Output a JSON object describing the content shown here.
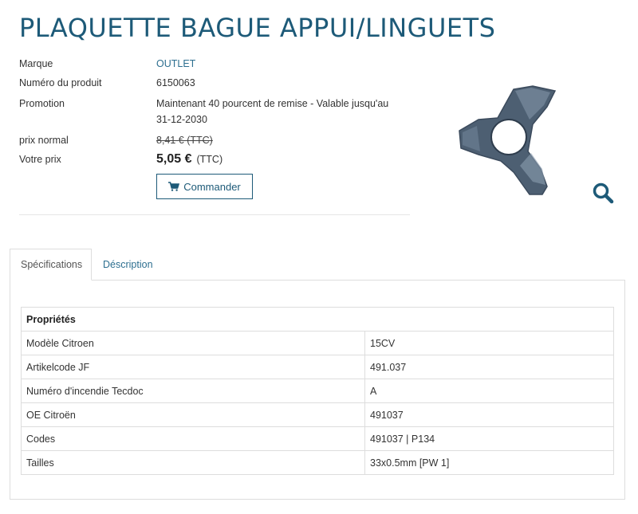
{
  "product": {
    "title": "PLAQUETTE BAGUE APPUI/LINGUETS",
    "brand_label": "Marque",
    "brand_value": "OUTLET",
    "number_label": "Numéro du produit",
    "number_value": "6150063",
    "promo_label": "Promotion",
    "promo_line1": "Maintenant 40 pourcent de remise - Valable jusqu'au",
    "promo_line2": "31-12-2030",
    "normal_label": "prix normal",
    "normal_value": "8,41 €  (TTC)",
    "price_label": "Votre prix",
    "price_amount": "5,05 €",
    "price_suffix": "(TTC)",
    "order_label": "Commander"
  },
  "tabs": [
    {
      "label": "Spécifications",
      "active": true
    },
    {
      "label": "Déscription",
      "active": false
    }
  ],
  "specs": {
    "header": "Propriétés",
    "rows": [
      {
        "name": "Modèle Citroen",
        "value": "15CV"
      },
      {
        "name": "Artikelcode JF",
        "value": "491.037"
      },
      {
        "name": "Numéro d'incendie Tecdoc",
        "value": "A"
      },
      {
        "name": "OE Citroën",
        "value": "491037"
      },
      {
        "name": "Codes",
        "value": "491037 | P134"
      },
      {
        "name": "Tailles",
        "value": "33x0.5mm [PW 1]"
      }
    ]
  },
  "icons": {
    "cart": "cart-icon",
    "zoom": "magnifier-icon"
  },
  "colors": {
    "brand": "#1d5a78",
    "link": "#2d6f90",
    "border": "#dddddd"
  }
}
